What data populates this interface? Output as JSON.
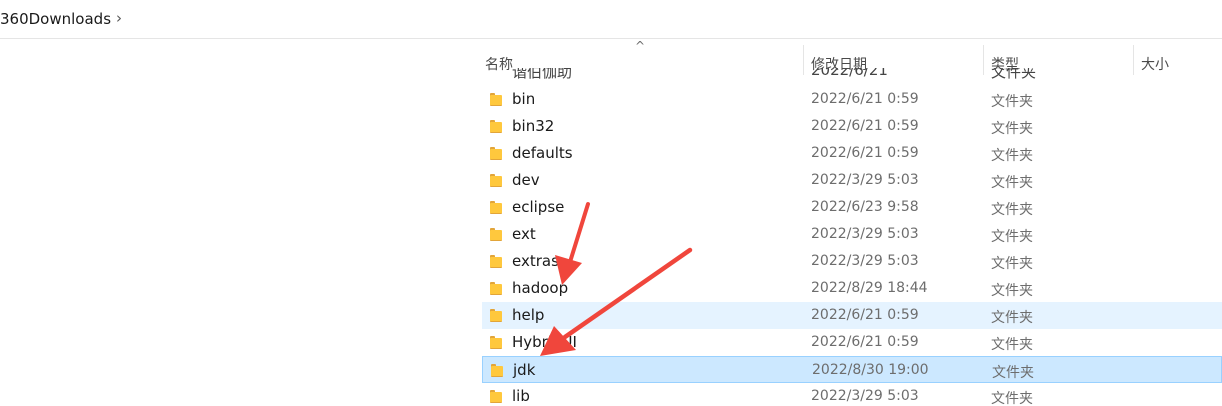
{
  "address_bar": {
    "crumb": "360Downloads",
    "chevron": "›"
  },
  "columns": {
    "name": "名称",
    "modified": "修改日期",
    "type": "类型",
    "size": "大小",
    "sort_indicator": "^"
  },
  "clipped_row": {
    "name": "谐伯伽助",
    "date": "2022/6/21",
    "type": "文件夹"
  },
  "rows": [
    {
      "name": "bin",
      "date": "2022/6/21 0:59",
      "type": "文件夹"
    },
    {
      "name": "bin32",
      "date": "2022/6/21 0:59",
      "type": "文件夹"
    },
    {
      "name": "defaults",
      "date": "2022/6/21 0:59",
      "type": "文件夹"
    },
    {
      "name": "dev",
      "date": "2022/3/29 5:03",
      "type": "文件夹"
    },
    {
      "name": "eclipse",
      "date": "2022/6/23 9:58",
      "type": "文件夹"
    },
    {
      "name": "ext",
      "date": "2022/3/29 5:03",
      "type": "文件夹"
    },
    {
      "name": "extras",
      "date": "2022/3/29 5:03",
      "type": "文件夹"
    },
    {
      "name": "hadoop",
      "date": "2022/8/29 18:44",
      "type": "文件夹"
    },
    {
      "name": "help",
      "date": "2022/6/21 0:59",
      "type": "文件夹"
    },
    {
      "name": "HybridUI",
      "date": "2022/6/21 0:59",
      "type": "文件夹"
    },
    {
      "name": "jdk",
      "date": "2022/8/30 19:00",
      "type": "文件夹"
    },
    {
      "name": "lib",
      "date": "2022/3/29 5:03",
      "type": "文件夹"
    }
  ],
  "states": {
    "hover_row": 8,
    "selected_row": 10
  },
  "colors": {
    "hover": "#e5f3ff",
    "selected": "#cce8ff",
    "arrow": "#f0463c",
    "folder": "#ffc83d"
  },
  "annotation_icons": [
    "red-arrow-icon",
    "red-arrow-icon"
  ]
}
